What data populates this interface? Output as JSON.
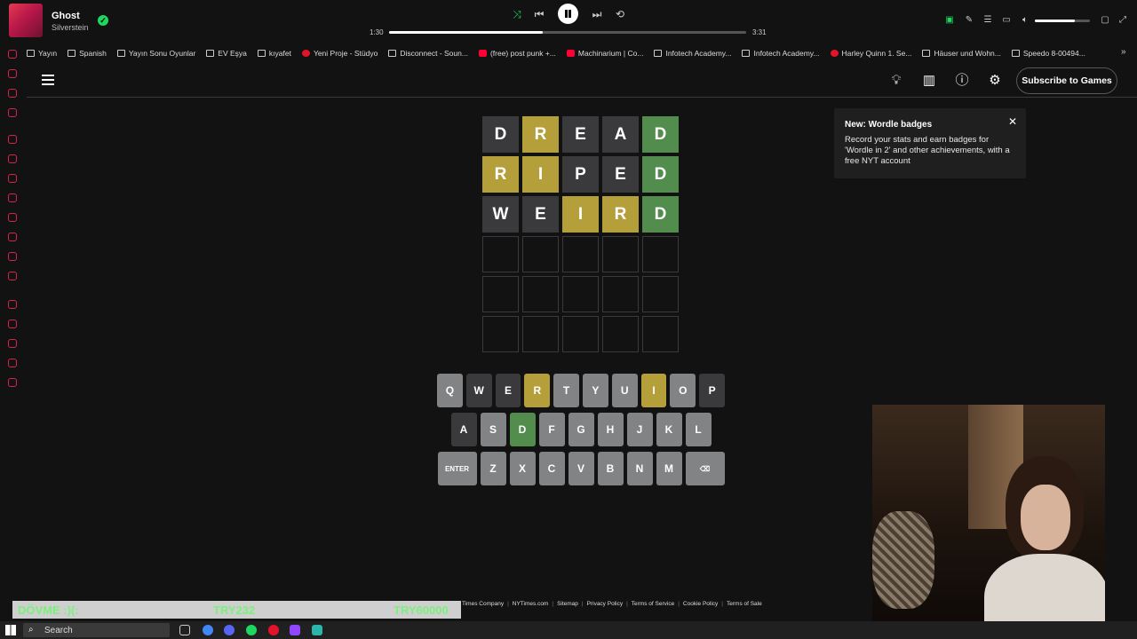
{
  "media": {
    "track_title": "Ghost",
    "track_artist": "Silverstein",
    "elapsed": "1:30",
    "total": "3:31",
    "progress": 0.43,
    "volume": 0.72
  },
  "bookmarks": [
    {
      "label": "Yayın",
      "icon": "folder"
    },
    {
      "label": "Spanish",
      "icon": "folder"
    },
    {
      "label": "Yayın Sonu Oyunlar",
      "icon": "folder"
    },
    {
      "label": "EV Eşya",
      "icon": "folder"
    },
    {
      "label": "kıyafet",
      "icon": "folder"
    },
    {
      "label": "Yeni Proje - Stüdyo",
      "icon": "red"
    },
    {
      "label": "Disconnect - Soun...",
      "icon": "folder"
    },
    {
      "label": "(free) post punk +...",
      "icon": "yt"
    },
    {
      "label": "Machinarium | Co...",
      "icon": "yt"
    },
    {
      "label": "Infotech Academy...",
      "icon": "folder"
    },
    {
      "label": "Infotech Academy...",
      "icon": "folder"
    },
    {
      "label": "Harley Quinn 1. Se...",
      "icon": "red"
    },
    {
      "label": "Häuser und Wohn...",
      "icon": "folder"
    },
    {
      "label": "Speedo 8-00494...",
      "icon": "folder"
    }
  ],
  "header": {
    "subscribe_label": "Subscribe to Games"
  },
  "board": {
    "rows": [
      [
        {
          "l": "D",
          "s": "absent"
        },
        {
          "l": "R",
          "s": "present"
        },
        {
          "l": "E",
          "s": "absent"
        },
        {
          "l": "A",
          "s": "absent"
        },
        {
          "l": "D",
          "s": "correct"
        }
      ],
      [
        {
          "l": "R",
          "s": "present"
        },
        {
          "l": "I",
          "s": "present"
        },
        {
          "l": "P",
          "s": "absent"
        },
        {
          "l": "E",
          "s": "absent"
        },
        {
          "l": "D",
          "s": "correct"
        }
      ],
      [
        {
          "l": "W",
          "s": "absent"
        },
        {
          "l": "E",
          "s": "absent"
        },
        {
          "l": "I",
          "s": "present"
        },
        {
          "l": "R",
          "s": "present"
        },
        {
          "l": "D",
          "s": "correct"
        }
      ],
      [
        {
          "l": "",
          "s": "empty"
        },
        {
          "l": "",
          "s": "empty"
        },
        {
          "l": "",
          "s": "empty"
        },
        {
          "l": "",
          "s": "empty"
        },
        {
          "l": "",
          "s": "empty"
        }
      ],
      [
        {
          "l": "",
          "s": "empty"
        },
        {
          "l": "",
          "s": "empty"
        },
        {
          "l": "",
          "s": "empty"
        },
        {
          "l": "",
          "s": "empty"
        },
        {
          "l": "",
          "s": "empty"
        }
      ],
      [
        {
          "l": "",
          "s": "empty"
        },
        {
          "l": "",
          "s": "empty"
        },
        {
          "l": "",
          "s": "empty"
        },
        {
          "l": "",
          "s": "empty"
        },
        {
          "l": "",
          "s": "empty"
        }
      ]
    ]
  },
  "keyboard": {
    "rows": [
      [
        {
          "k": "Q",
          "s": "unused"
        },
        {
          "k": "W",
          "s": "absent"
        },
        {
          "k": "E",
          "s": "absent"
        },
        {
          "k": "R",
          "s": "present"
        },
        {
          "k": "T",
          "s": "unused"
        },
        {
          "k": "Y",
          "s": "unused"
        },
        {
          "k": "U",
          "s": "unused"
        },
        {
          "k": "I",
          "s": "present"
        },
        {
          "k": "O",
          "s": "unused"
        },
        {
          "k": "P",
          "s": "absent"
        }
      ],
      [
        {
          "k": "A",
          "s": "absent"
        },
        {
          "k": "S",
          "s": "unused"
        },
        {
          "k": "D",
          "s": "correct"
        },
        {
          "k": "F",
          "s": "unused"
        },
        {
          "k": "G",
          "s": "unused"
        },
        {
          "k": "H",
          "s": "unused"
        },
        {
          "k": "J",
          "s": "unused"
        },
        {
          "k": "K",
          "s": "unused"
        },
        {
          "k": "L",
          "s": "unused"
        }
      ],
      [
        {
          "k": "ENTER",
          "s": "unused",
          "wide": true
        },
        {
          "k": "Z",
          "s": "unused"
        },
        {
          "k": "X",
          "s": "unused"
        },
        {
          "k": "C",
          "s": "unused"
        },
        {
          "k": "V",
          "s": "unused"
        },
        {
          "k": "B",
          "s": "unused"
        },
        {
          "k": "N",
          "s": "unused"
        },
        {
          "k": "M",
          "s": "unused"
        },
        {
          "k": "⌫",
          "s": "unused",
          "wide": true
        }
      ]
    ]
  },
  "toast": {
    "title": "New: Wordle badges",
    "body": "Record your stats and earn badges for 'Wordle in 2' and other achievements, with a free NYT account",
    "close": "✕"
  },
  "footer": [
    "Times Company",
    "NYTimes.com",
    "Sitemap",
    "Privacy Policy",
    "Terms of Service",
    "Cookie Policy",
    "Terms of Sale"
  ],
  "ticker": {
    "left": "DÖVME :)(:",
    "middle": "TRY232",
    "right": "TRY60000"
  },
  "taskbar": {
    "search_label": "Search"
  },
  "colors": {
    "correct": "#538d4e",
    "present": "#b59f3b",
    "absent": "#3a3a3c",
    "unused_key": "#818384",
    "background": "#121213",
    "spotify_green": "#1ed760"
  }
}
